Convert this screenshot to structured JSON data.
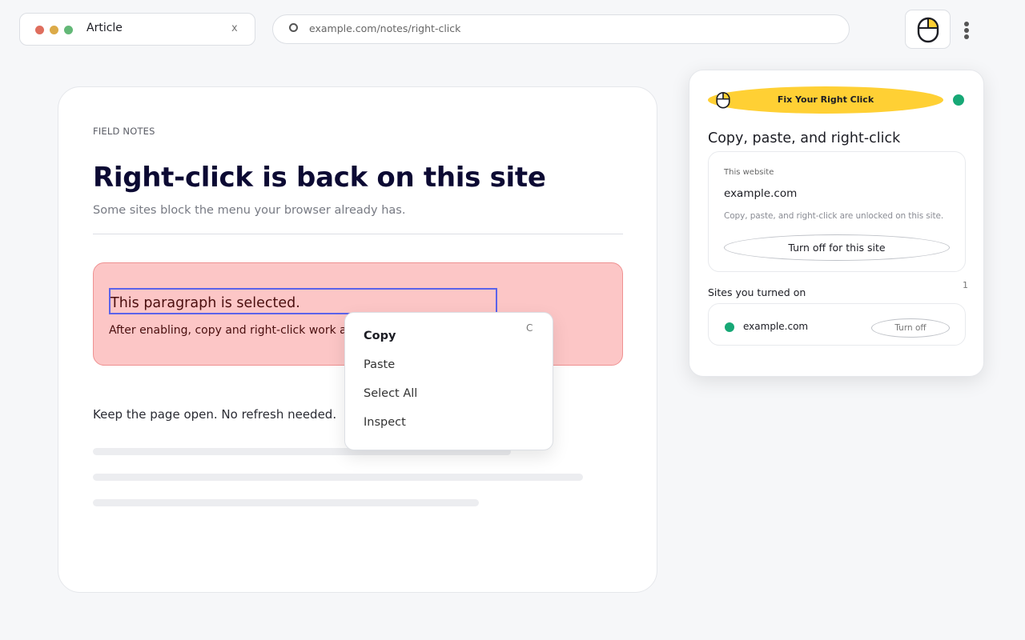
{
  "browser": {
    "tab_title": "Article",
    "tab_close": "x",
    "url": "example.com/notes/right-click"
  },
  "article": {
    "eyebrow": "FIELD NOTES",
    "headline": "Right-click is back on this site",
    "subline": "Some sites block the menu your browser already has.",
    "alert": {
      "selected_text": "This paragraph is selected.",
      "body": "After enabling, copy and right-click work again."
    },
    "keep_text": "Keep the page open. No refresh needed."
  },
  "context_menu": {
    "items": [
      {
        "label": "Copy",
        "shortcut": "C"
      },
      {
        "label": "Paste"
      },
      {
        "label": "Select All"
      },
      {
        "label": "Inspect"
      }
    ]
  },
  "popup": {
    "brand": "Fix Your Right Click",
    "title": "Copy, paste, and right-click",
    "site_label": "This website",
    "site_domain": "example.com",
    "site_note": "Copy, paste, and right-click are unlocked on this site.",
    "turn_off_site_label": "Turn off for this site",
    "sites_heading": "Sites you turned on",
    "sites_count": "1",
    "sites": [
      {
        "domain": "example.com",
        "action": "Turn off"
      }
    ]
  },
  "colors": {
    "accent_yellow": "#ffd034",
    "status_green": "#17a876",
    "selection_blue": "#5b63ea",
    "alert_bg": "#fcc6c6",
    "headline": "#0c0a33"
  },
  "icons": [
    "mouse-icon",
    "globe-icon",
    "more-vertical-icon",
    "status-dot-icon"
  ]
}
